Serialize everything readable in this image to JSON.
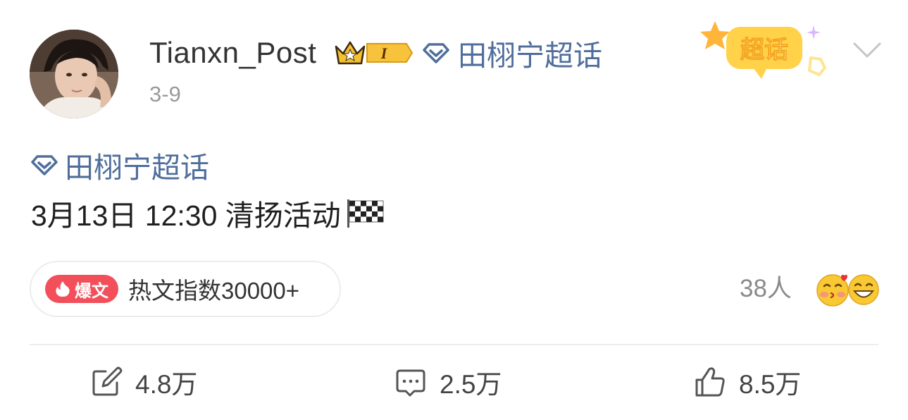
{
  "post": {
    "username": "Tianxn_Post",
    "vip_level": "I",
    "topic_inline": "田栩宁超话",
    "date": "3-9",
    "badge_label": "超话",
    "topic": "田栩宁超话",
    "text": "3月13日 12:30 清扬活动"
  },
  "hot": {
    "tag_label": "爆文",
    "index_text": "热文指数30000+"
  },
  "reactions": {
    "count_text": "38人"
  },
  "actions": {
    "repost": "4.8万",
    "comment": "2.5万",
    "like": "8.5万"
  },
  "colors": {
    "topic_blue": "#506e9c",
    "hot_red": "#f24f5a",
    "badge_gold": "#f5b93a"
  }
}
